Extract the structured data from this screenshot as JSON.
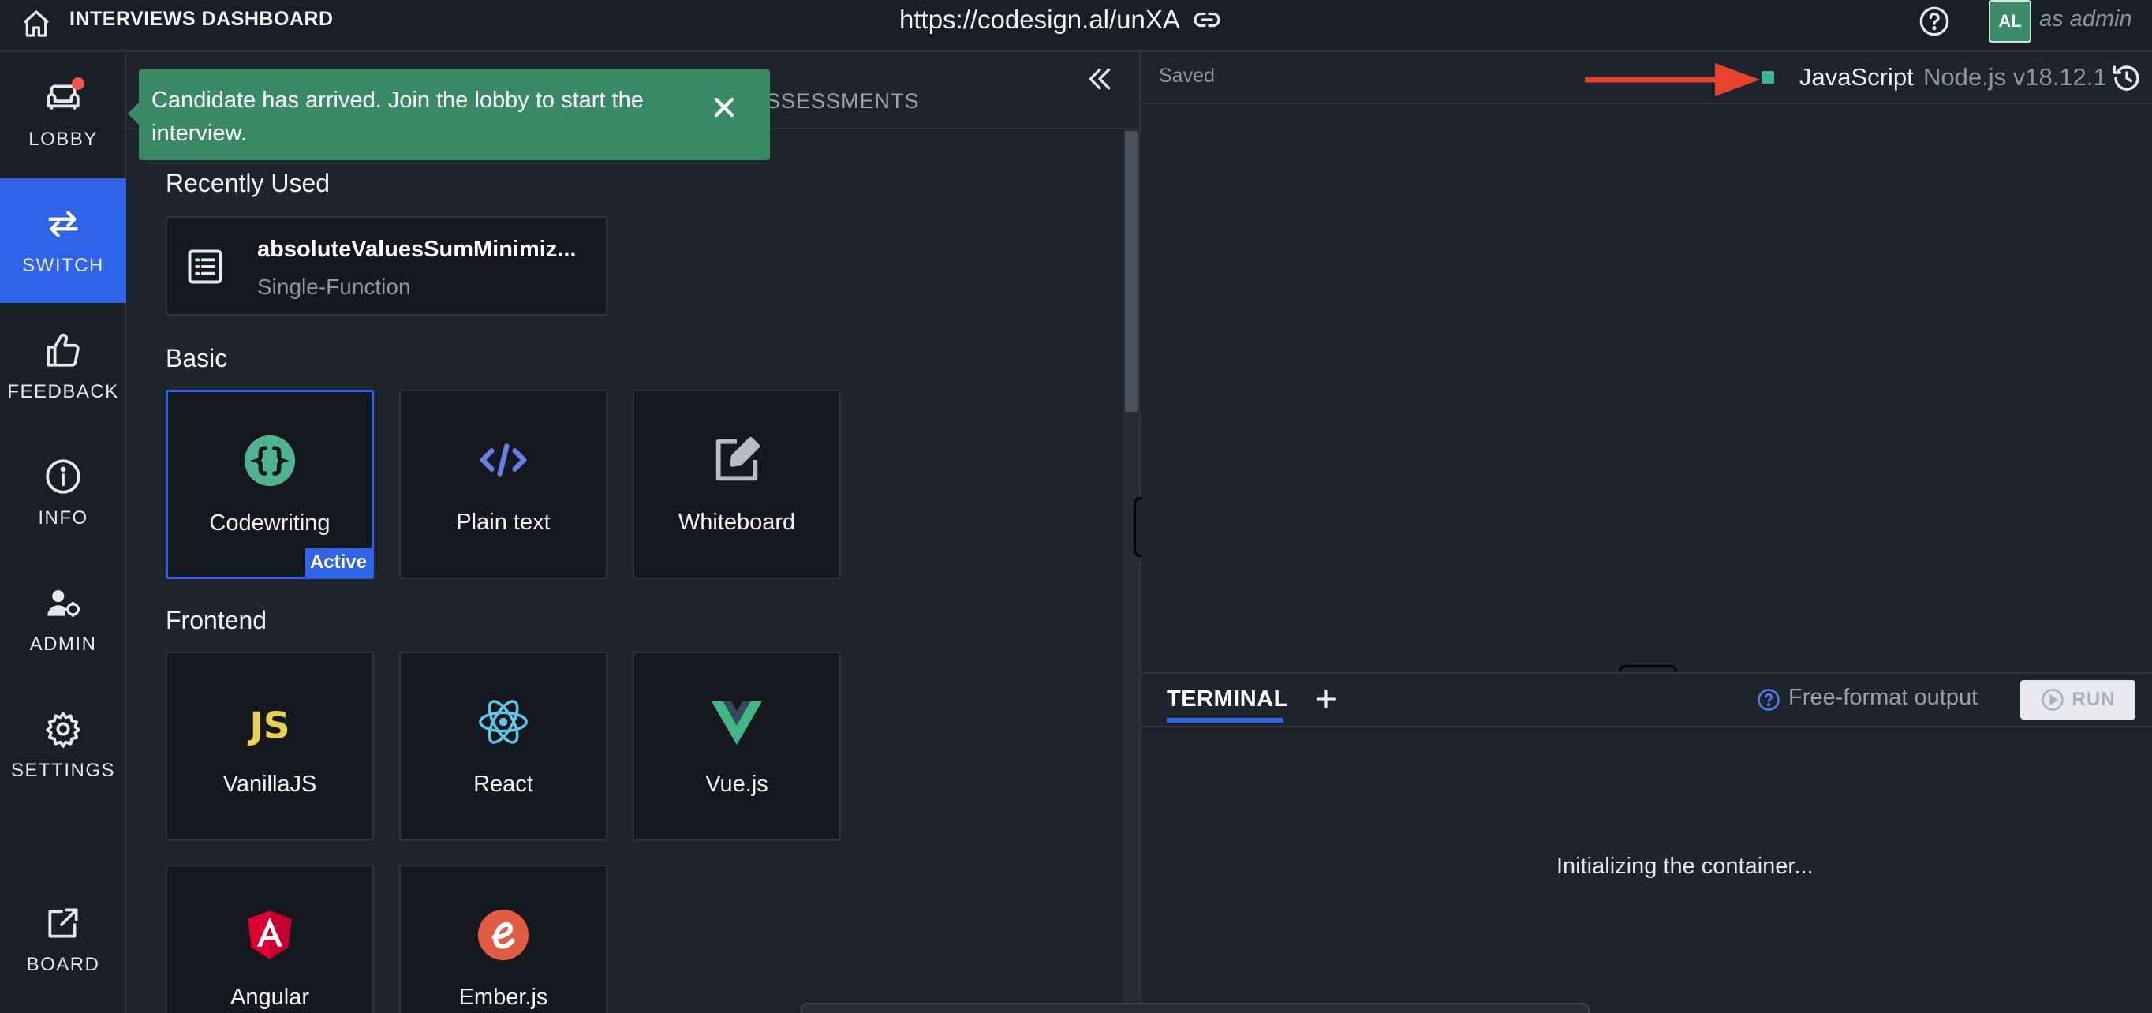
{
  "topbar": {
    "title": "INTERVIEWS DASHBOARD",
    "url": "https://codesign.al/unXA",
    "avatar_initials": "AL",
    "role_text": "as admin"
  },
  "sidebar": {
    "items": [
      {
        "label": "LOBBY",
        "icon": "couch-icon",
        "notification": true
      },
      {
        "label": "SWITCH",
        "icon": "swap-arrows-icon",
        "active": true
      },
      {
        "label": "FEEDBACK",
        "icon": "thumbs-up-icon"
      },
      {
        "label": "INFO",
        "icon": "info-icon"
      },
      {
        "label": "ADMIN",
        "icon": "user-gear-icon"
      },
      {
        "label": "SETTINGS",
        "icon": "gear-icon"
      },
      {
        "label": "BOARD",
        "icon": "external-link-icon"
      }
    ]
  },
  "panel": {
    "tab_assessments": "ASSESSMENTS",
    "toast": "Candidate has arrived. Join the lobby to start the interview.",
    "recently_used_title": "Recently Used",
    "recent_item": {
      "title": "absoluteValuesSumMinimiz...",
      "subtitle": "Single-Function"
    },
    "basic_title": "Basic",
    "basic": [
      {
        "label": "Codewriting",
        "icon": "braces-icon",
        "active": true
      },
      {
        "label": "Plain text",
        "icon": "code-icon"
      },
      {
        "label": "Whiteboard",
        "icon": "edit-icon"
      }
    ],
    "active_badge": "Active",
    "frontend_title": "Frontend",
    "frontend": [
      {
        "label": "VanillaJS",
        "icon": "js-icon"
      },
      {
        "label": "React",
        "icon": "react-icon"
      },
      {
        "label": "Vue.js",
        "icon": "vue-icon"
      },
      {
        "label": "Angular",
        "icon": "angular-icon"
      },
      {
        "label": "Ember.js",
        "icon": "ember-icon"
      }
    ]
  },
  "editor": {
    "status": "Saved",
    "language": "JavaScript",
    "runtime": "Node.js v18.12.1"
  },
  "terminal": {
    "tab": "TERMINAL",
    "output_mode": "Free-format output",
    "run_label": "RUN",
    "status": "Initializing the container..."
  },
  "colors": {
    "accent": "#2f63e8",
    "toast": "#3a8a66",
    "status_dot": "#3fb58c",
    "arrow": "#e8412c"
  }
}
